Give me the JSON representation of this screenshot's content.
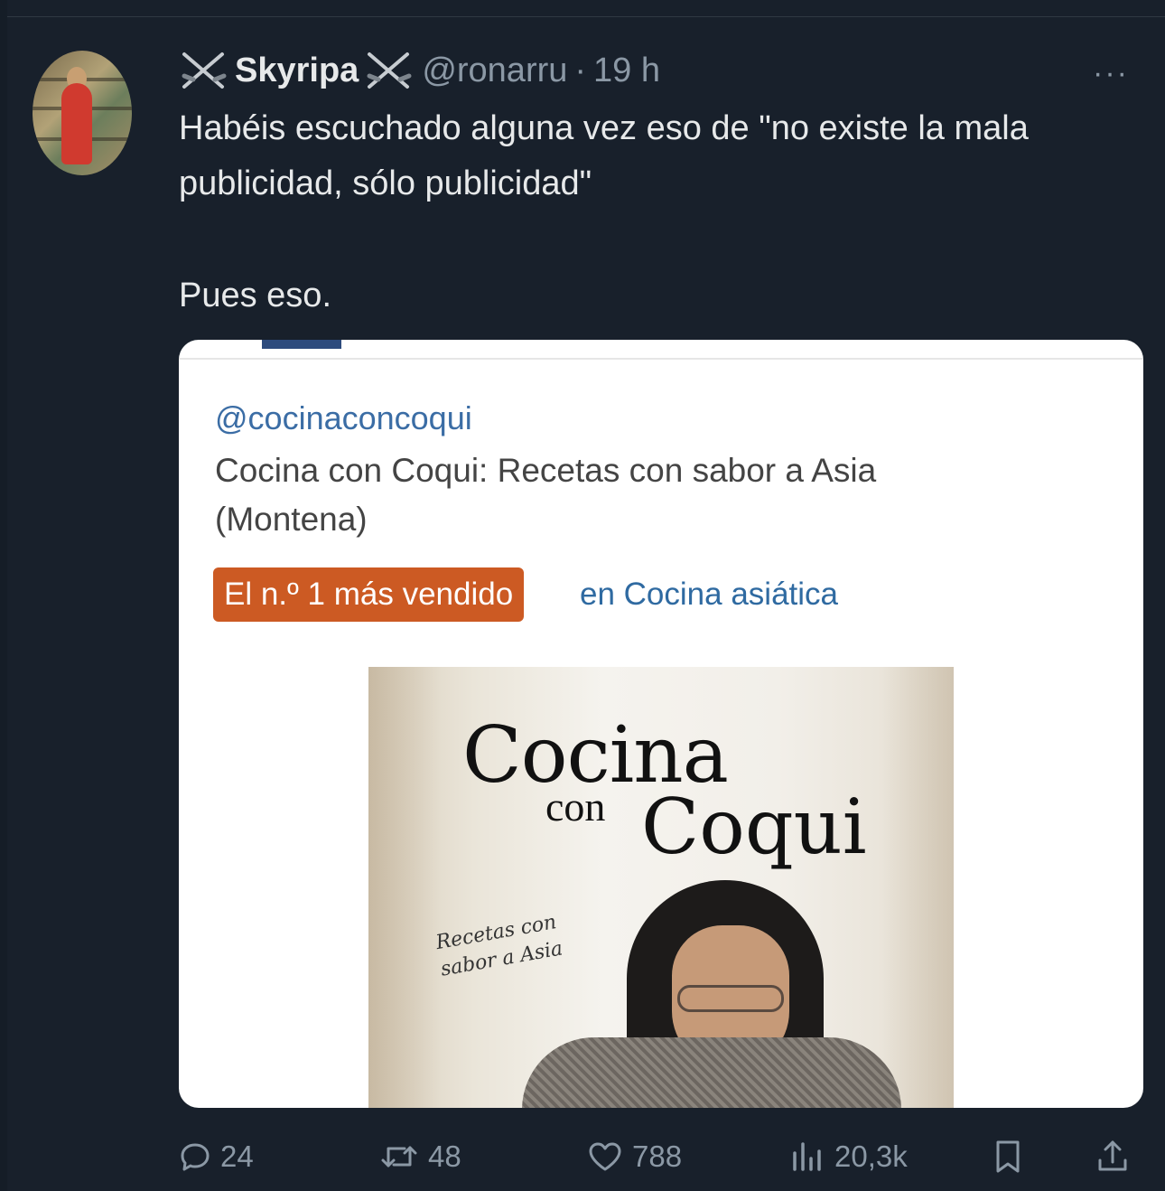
{
  "tweet": {
    "display_name": "Skyripa",
    "handle": "@ronarru",
    "separator": "·",
    "time": "19 h",
    "more_label": "···",
    "text_line1": "Habéis escuchado alguna vez eso de \"no existe la mala publicidad, sólo publicidad\"",
    "text_line2": "Pues eso."
  },
  "card": {
    "handle": "@cocinaconcoqui",
    "title": "Cocina con Coqui: Recetas con sabor a Asia (Montena)",
    "badge": "El n.º 1 más vendido",
    "category": "en Cocina asiática",
    "cover": {
      "title": "Cocina",
      "con": "con",
      "coqui": "Coqui",
      "subtitle_line1": "Recetas con",
      "subtitle_line2": "sabor a Asia"
    }
  },
  "actions": {
    "replies": "24",
    "reposts": "48",
    "likes": "788",
    "views": "20,3k"
  },
  "icons": [
    "crossed-swords-icon",
    "more-icon",
    "reply-icon",
    "repost-icon",
    "like-icon",
    "views-icon",
    "bookmark-icon",
    "share-icon"
  ]
}
